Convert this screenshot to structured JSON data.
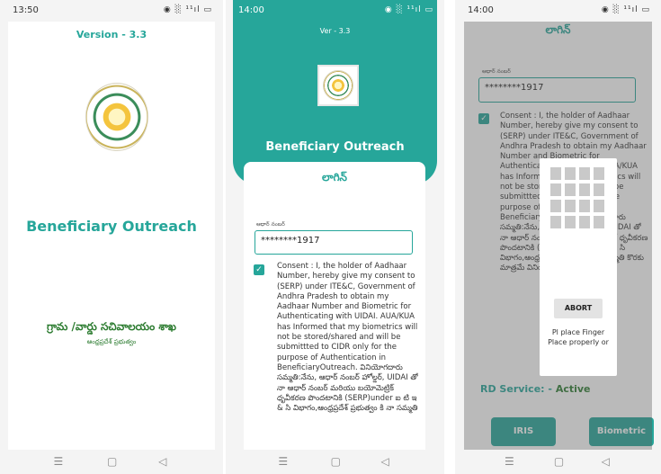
{
  "screen1": {
    "status_time": "13:50",
    "status_icons": "◉ ░ ¹¹ıl ▭",
    "version": "Version - 3.3",
    "title": "Beneficiary Outreach",
    "department": "గ్రామ /వార్డు సచివాలయం శాఖ",
    "government": "ఆంధ్రప్రదేశ్ ప్రభుత్వం"
  },
  "screen2": {
    "status_time": "14:00",
    "status_icons": "◉ ░ ¹¹ıl ▭",
    "version": "Ver - 3.3",
    "title": "Beneficiary Outreach",
    "card_title": "లాగిన్",
    "aadhaar_label": "ఆధార్ నంబర్",
    "aadhaar_value": "********1917",
    "consent": "Consent : I, the holder of Aadhaar Number, hereby give my consent to (SERP) under ITE&C, Government of Andhra Pradesh to obtain my Aadhaar Number and Biometric for Authenticating with UIDAI. AUA/KUA has Informed that my biometrics will not be stored/shared and will be submittted to CIDR only for the purpose of Authentication in BeneficiaryOutreach. వినియోగదారు సమ్మతి:నేను, ఆధార్ నంబర్ హోల్డర్, UIDAI తో నా ఆధార్ నంబర్ మరియు బయోమెట్రిక్ ధృవీకరణ పొందటానికి (SERP)under ఐ టి ఇ & సి విభాగం,ఆంధ్రప్రదేశ్ ప్రభుత్వం కి నా సమ్మతి"
  },
  "screen3": {
    "status_time": "14:00",
    "status_icons": "◉ ░ ¹¹ıl ▭",
    "card_title": "లాగిన్",
    "aadhaar_label": "ఆధార్ నంబర్",
    "aadhaar_value": "********1917",
    "consent": "Consent : I, the holder of Aadhaar Number, hereby give my consent to (SERP) under ITE&C, Government of Andhra Pradesh to obtain my Aadhaar Number and Biometric for Authenticating with UIDAI. AUA/KUA has Informed that my biometrics will not be stored/shared and will be submittted to CIDR only for the purpose of Authentication in BeneficiaryOutreach. వినియోగదారు సమ్మతి:నేను, ఆధార్ నంబర్ హోల్డర్, UIDAI తో నా ఆధార్ నంబర్ మరియు బయోమెట్రిక్ ధృవీకరణ పొందటానికి (SERP)under ఐ టి ఇ & సి విభాగం,ఆంధ్రప్రదేశ్ ప్రభుత్వం కి నా సమ్మతి కొరకు మాత్రమే వినియోగించబడుతుంది.",
    "rd_label": "RD Service: -",
    "rd_status": "Active",
    "iris_button": "IRIS",
    "biometric_button": "Biometric",
    "abort_button": "ABORT",
    "finger_message": "Pl place Finger Place properly or"
  },
  "nav": {
    "menu_icon": "☰",
    "home_icon": "▢",
    "back_icon": "◁"
  },
  "colors": {
    "primary": "#26a69a",
    "active": "#2e7d32"
  }
}
